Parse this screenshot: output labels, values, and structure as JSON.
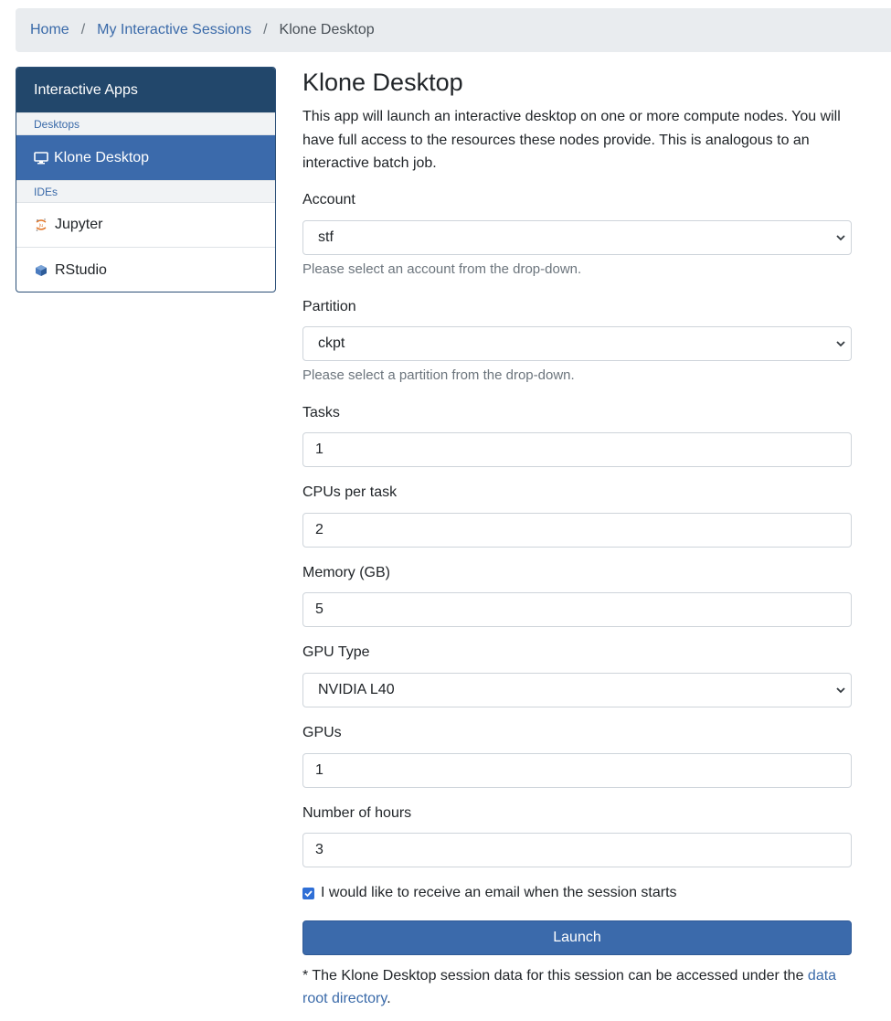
{
  "breadcrumb": {
    "home": "Home",
    "sessions": "My Interactive Sessions",
    "current": "Klone Desktop",
    "separator": "/"
  },
  "sidebar": {
    "title": "Interactive Apps",
    "categories": [
      {
        "label": "Desktops"
      },
      {
        "label": "IDEs"
      }
    ],
    "items": [
      {
        "label": "Klone Desktop",
        "icon": "monitor-icon",
        "active": true
      },
      {
        "label": "Jupyter",
        "icon": "jupyter-icon"
      },
      {
        "label": "RStudio",
        "icon": "rstudio-icon"
      }
    ]
  },
  "app": {
    "title": "Klone Desktop",
    "description": "This app will launch an interactive desktop on one or more compute nodes. You will have full access to the resources these nodes provide. This is analogous to an interactive batch job."
  },
  "form": {
    "account": {
      "label": "Account",
      "value": "stf",
      "help": "Please select an account from the drop-down."
    },
    "partition": {
      "label": "Partition",
      "value": "ckpt",
      "help": "Please select a partition from the drop-down."
    },
    "tasks": {
      "label": "Tasks",
      "value": "1"
    },
    "cpus": {
      "label": "CPUs per task",
      "value": "2"
    },
    "memory": {
      "label": "Memory (GB)",
      "value": "5"
    },
    "gpu_type": {
      "label": "GPU Type",
      "value": "NVIDIA L40"
    },
    "gpus": {
      "label": "GPUs",
      "value": "1"
    },
    "hours": {
      "label": "Number of hours",
      "value": "3"
    },
    "email": {
      "label": "I would like to receive an email when the session starts",
      "checked": true
    },
    "launch_label": "Launch"
  },
  "footnote": {
    "text": "* The Klone Desktop session data for this session can be accessed under the ",
    "link": "data root directory",
    "end": "."
  },
  "colors": {
    "primary": "#3b6aab",
    "sidebar_header": "#22476b",
    "link": "#3a6aa9",
    "breadcrumb_bg": "#e9ecef"
  }
}
